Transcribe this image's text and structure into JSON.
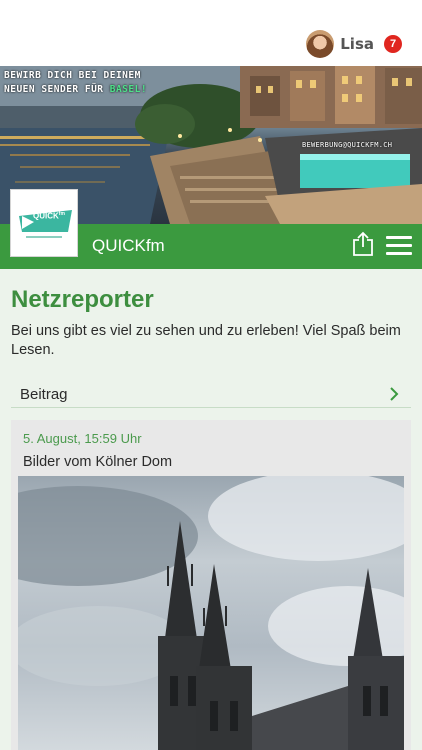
{
  "header": {
    "user_name": "Lisa",
    "notification_count": "7",
    "avatar_icon": "user-avatar"
  },
  "banner": {
    "line1": "BEWIRB DICH BEI DEINEM",
    "line2_prefix": "NEUEN SENDER FÜR ",
    "line2_highlight": "BASEL!",
    "url": "BEWERBUNG@QUICKFM.CH",
    "highlight_color": "#4ee08a"
  },
  "station": {
    "name": "QUICKfm",
    "logo_text": "QUICK",
    "logo_sup": "fm",
    "share_icon": "share-icon",
    "menu_icon": "hamburger-menu-icon",
    "brand_color": "#3b9a3f"
  },
  "page": {
    "title": "Netzreporter",
    "intro": "Bei uns gibt es viel zu sehen und zu erleben! Viel Spaß beim Lesen."
  },
  "section": {
    "label": "Beitrag",
    "chevron_icon": "chevron-right-icon"
  },
  "post": {
    "date": "5. August, 15:59 Uhr",
    "title": "Bilder vom Kölner Dom"
  }
}
